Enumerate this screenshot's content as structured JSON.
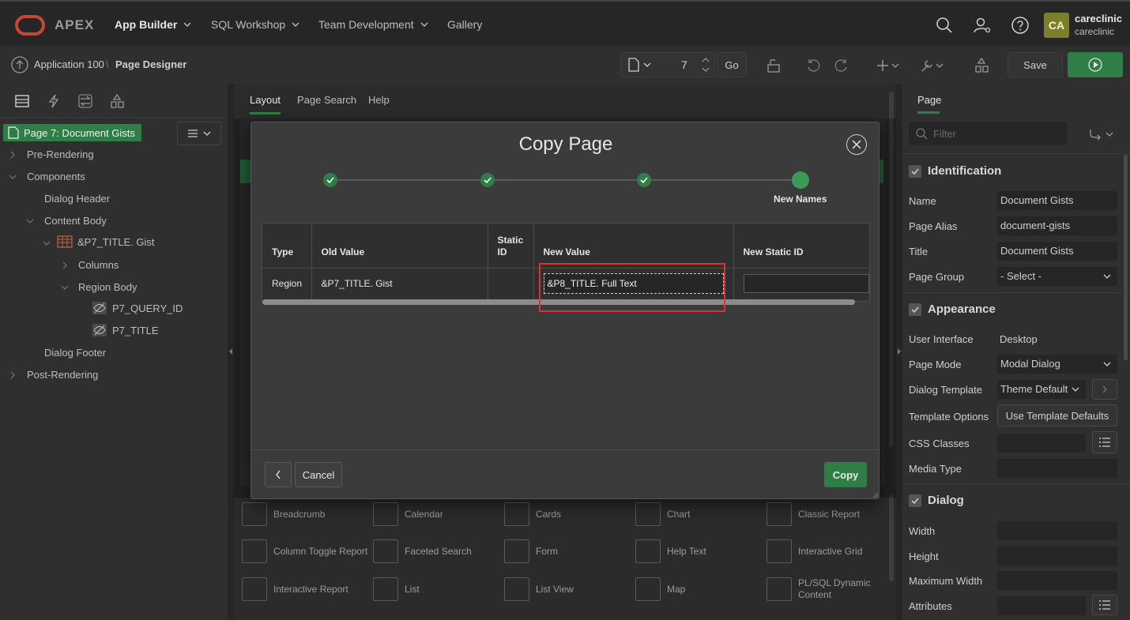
{
  "topbar": {
    "logo": "APEX",
    "nav": [
      "App Builder",
      "SQL Workshop",
      "Team Development",
      "Gallery"
    ],
    "avatar_initials": "CA",
    "user_name": "careclinic",
    "user_workspace": "careclinic"
  },
  "toolbar": {
    "breadcrumb_app": "Application 100",
    "breadcrumb_sep": "\\",
    "breadcrumb_page": "Page Designer",
    "page_number": "7",
    "go_label": "Go",
    "save_label": "Save"
  },
  "left": {
    "page_item": "Page 7: Document Gists",
    "tree": {
      "pre_rendering": "Pre-Rendering",
      "components": "Components",
      "dialog_header": "Dialog Header",
      "content_body": "Content Body",
      "region": "&P7_TITLE. Gist",
      "columns": "Columns",
      "region_body": "Region Body",
      "item1": "P7_QUERY_ID",
      "item2": "P7_TITLE",
      "dialog_footer": "Dialog Footer",
      "post_rendering": "Post-Rendering"
    }
  },
  "center": {
    "tabs": [
      "Layout",
      "Page Search",
      "Help"
    ],
    "gallery": [
      "Breadcrumb",
      "Calendar",
      "Cards",
      "Chart",
      "Classic Report",
      "Column Toggle Report",
      "Faceted Search",
      "Form",
      "Help Text",
      "Interactive Grid",
      "Interactive Report",
      "List",
      "List View",
      "Map",
      "PL/SQL Dynamic Content"
    ]
  },
  "modal": {
    "title": "Copy Page",
    "current_step": "New Names",
    "columns": [
      "Type",
      "Old Value",
      "Static ID",
      "New Value",
      "New Static ID"
    ],
    "row": {
      "type": "Region",
      "old_value": "&P7_TITLE. Gist",
      "static_id": "",
      "new_value": "&P8_TITLE. Full Text",
      "new_static_id": ""
    },
    "cancel_label": "Cancel",
    "copy_label": "Copy"
  },
  "right": {
    "tab": "Page",
    "filter_placeholder": "Filter",
    "identification": {
      "title": "Identification",
      "name_label": "Name",
      "name": "Document Gists",
      "alias_label": "Page Alias",
      "alias": "document-gists",
      "title_label": "Title",
      "title_value": "Document Gists",
      "group_label": "Page Group",
      "group": "- Select -"
    },
    "appearance": {
      "title": "Appearance",
      "ui_label": "User Interface",
      "ui": "Desktop",
      "mode_label": "Page Mode",
      "mode": "Modal Dialog",
      "template_label": "Dialog Template",
      "template": "Theme Default",
      "options_label": "Template Options",
      "options_btn": "Use Template Defaults",
      "css_label": "CSS Classes",
      "media_label": "Media Type"
    },
    "dialog": {
      "title": "Dialog",
      "width_label": "Width",
      "height_label": "Height",
      "maxwidth_label": "Maximum Width",
      "attributes_label": "Attributes"
    }
  },
  "colors": {
    "accent": "#2f7d47",
    "highlight": "#d9362b",
    "brand": "#c74634"
  }
}
